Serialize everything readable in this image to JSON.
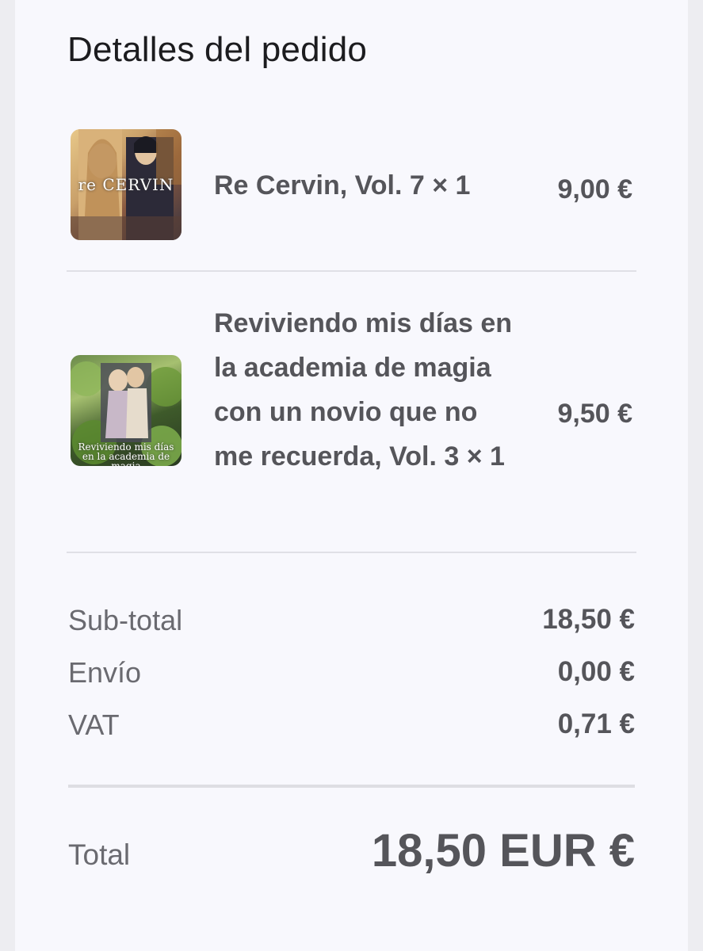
{
  "header": {
    "title": "Detalles del pedido"
  },
  "items": [
    {
      "name": "Re Cervin, Vol. 7 × 1",
      "price": "9,00 €",
      "cover_text": "re CERVIN",
      "cover_icon": "book-cover-icon"
    },
    {
      "name": "Reviviendo mis días en la academia de magia con un novio que no me recuerda, Vol. 3 × 1",
      "price": "9,50 €",
      "cover_text": "Reviviendo mis días en la academia de magia",
      "cover_icon": "book-cover-icon"
    }
  ],
  "summary": {
    "subtotal_label": "Sub-total",
    "subtotal_value": "18,50 €",
    "shipping_label": "Envío",
    "shipping_value": "0,00 €",
    "vat_label": "VAT",
    "vat_value": "0,71 €"
  },
  "total": {
    "label": "Total",
    "value": "18,50 EUR €"
  }
}
